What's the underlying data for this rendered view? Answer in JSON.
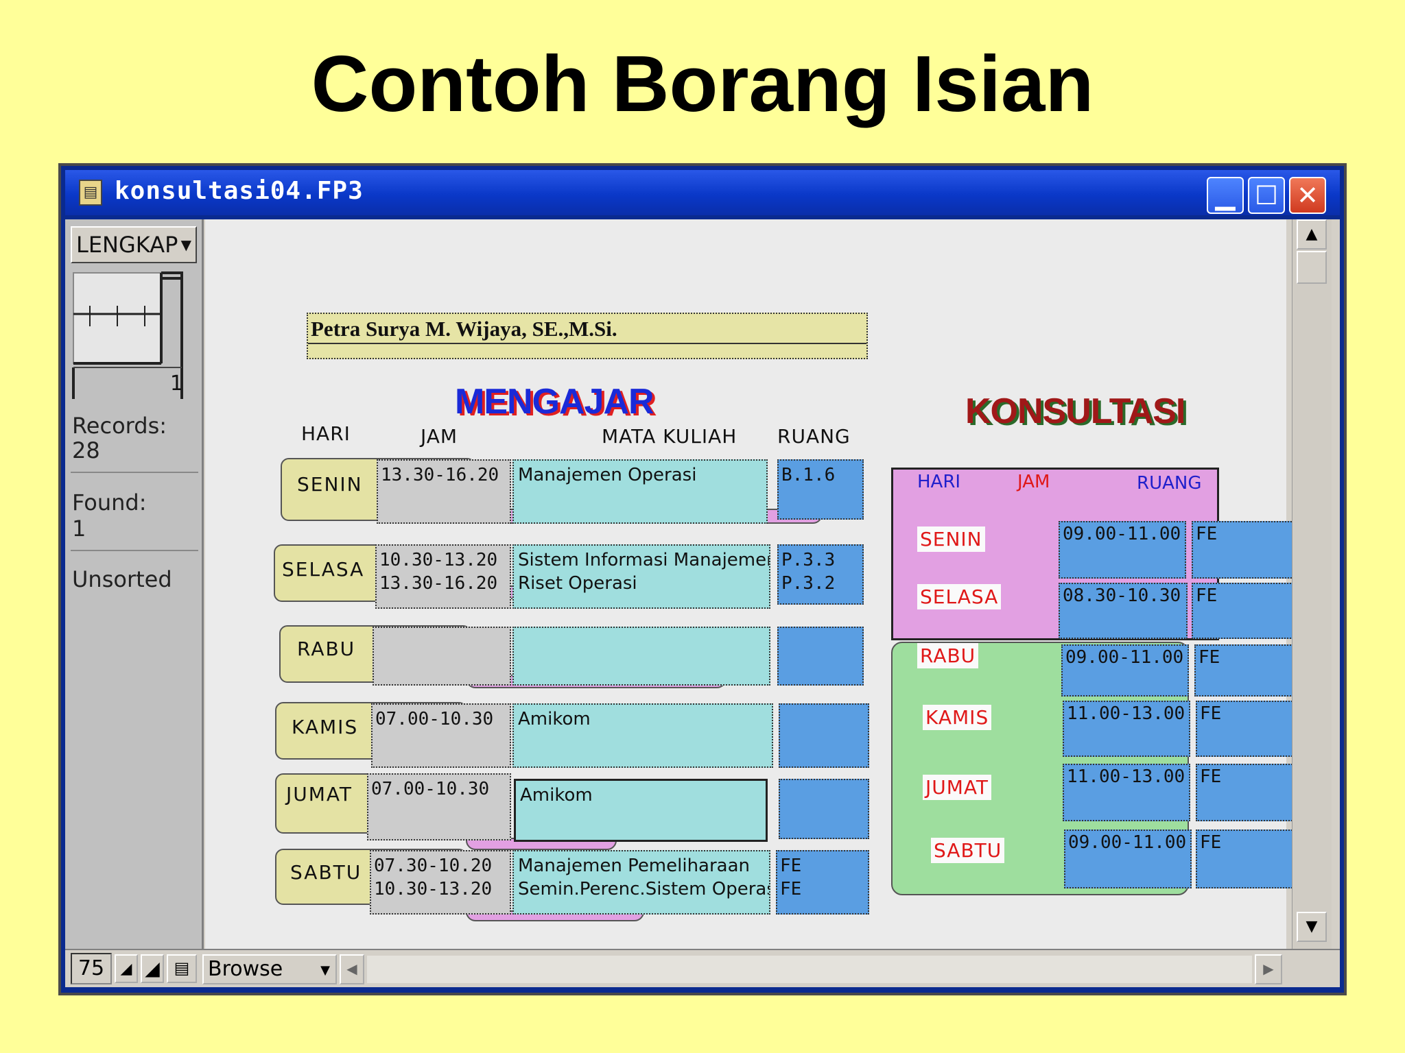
{
  "slide": {
    "title": "Contoh Borang Isian"
  },
  "window": {
    "title": "konsultasi04.FP3",
    "minimize": "▁",
    "maximize": "☐",
    "close": "✕"
  },
  "sidebar": {
    "layout_menu": "LENGKAP",
    "book_page": "1",
    "records_label": "Records:",
    "records_value": "28",
    "found_label": "Found:",
    "found_value": "1",
    "sort_status": "Unsorted"
  },
  "bottombar": {
    "zoom": "75",
    "mode": "Browse"
  },
  "record": {
    "name": "Petra Surya M. Wijaya, SE.,M.Si.",
    "mengajar": {
      "heading": "MENGAJAR",
      "columns": {
        "hari": "HARI",
        "jam": "JAM",
        "mata_kuliah": "MATA KULIAH",
        "ruang": "RUANG"
      },
      "rows": [
        {
          "day": "SENIN",
          "jam1": "13.30-16.20",
          "jam2": "",
          "mk1": "Manajemen Operasi",
          "mk2": "",
          "r1": "B.1.6",
          "r2": ""
        },
        {
          "day": "SELASA",
          "jam1": "10.30-13.20",
          "jam2": "13.30-16.20",
          "mk1": "Sistem Informasi Manajemen",
          "mk2": "Riset Operasi",
          "r1": "P.3.3",
          "r2": "P.3.2"
        },
        {
          "day": "RABU",
          "jam1": "",
          "jam2": "",
          "mk1": "",
          "mk2": "",
          "r1": "",
          "r2": ""
        },
        {
          "day": "KAMIS",
          "jam1": "07.00-10.30",
          "jam2": "",
          "mk1": "Amikom",
          "mk2": "",
          "r1": "",
          "r2": ""
        },
        {
          "day": "JUMAT",
          "jam1": "07.00-10.30",
          "jam2": "",
          "mk1": "Amikom",
          "mk2": "",
          "r1": "",
          "r2": ""
        },
        {
          "day": "SABTU",
          "jam1": "07.30-10.20",
          "jam2": "10.30-13.20",
          "mk1": "Manajemen Pemeliharaan",
          "mk2": "Semin.Perenc.Sistem Operasi",
          "r1": "FE",
          "r2": "FE"
        }
      ]
    },
    "konsultasi": {
      "heading": "KONSULTASI",
      "columns": {
        "hari": "HARI",
        "jam": "JAM",
        "ruang": "RUANG"
      },
      "rows": [
        {
          "day": "SENIN",
          "jam": "09.00-11.00",
          "ruang": "FE"
        },
        {
          "day": "SELASA",
          "jam": "08.30-10.30",
          "ruang": "FE"
        },
        {
          "day": "RABU",
          "jam": "09.00-11.00",
          "ruang": "FE"
        },
        {
          "day": "KAMIS",
          "jam": "11.00-13.00",
          "ruang": "FE"
        },
        {
          "day": "JUMAT",
          "jam": "11.00-13.00",
          "ruang": "FE"
        },
        {
          "day": "SABTU",
          "jam": "09.00-11.00",
          "ruang": "FE"
        }
      ]
    }
  },
  "colors": {
    "slide_bg": "#ffff99",
    "titlebar": "#0a38c8",
    "mengajar_heading": "#1a2ad8",
    "konsultasi_heading": "#a01818",
    "day_label": "#e4e2a4",
    "jam_field": "#cccccc",
    "mk_field": "#a0dede",
    "ruang_field": "#5a9ee2",
    "konsultasi_top_panel": "#e2a0e2",
    "konsultasi_bottom_panel": "#9ede9e"
  }
}
